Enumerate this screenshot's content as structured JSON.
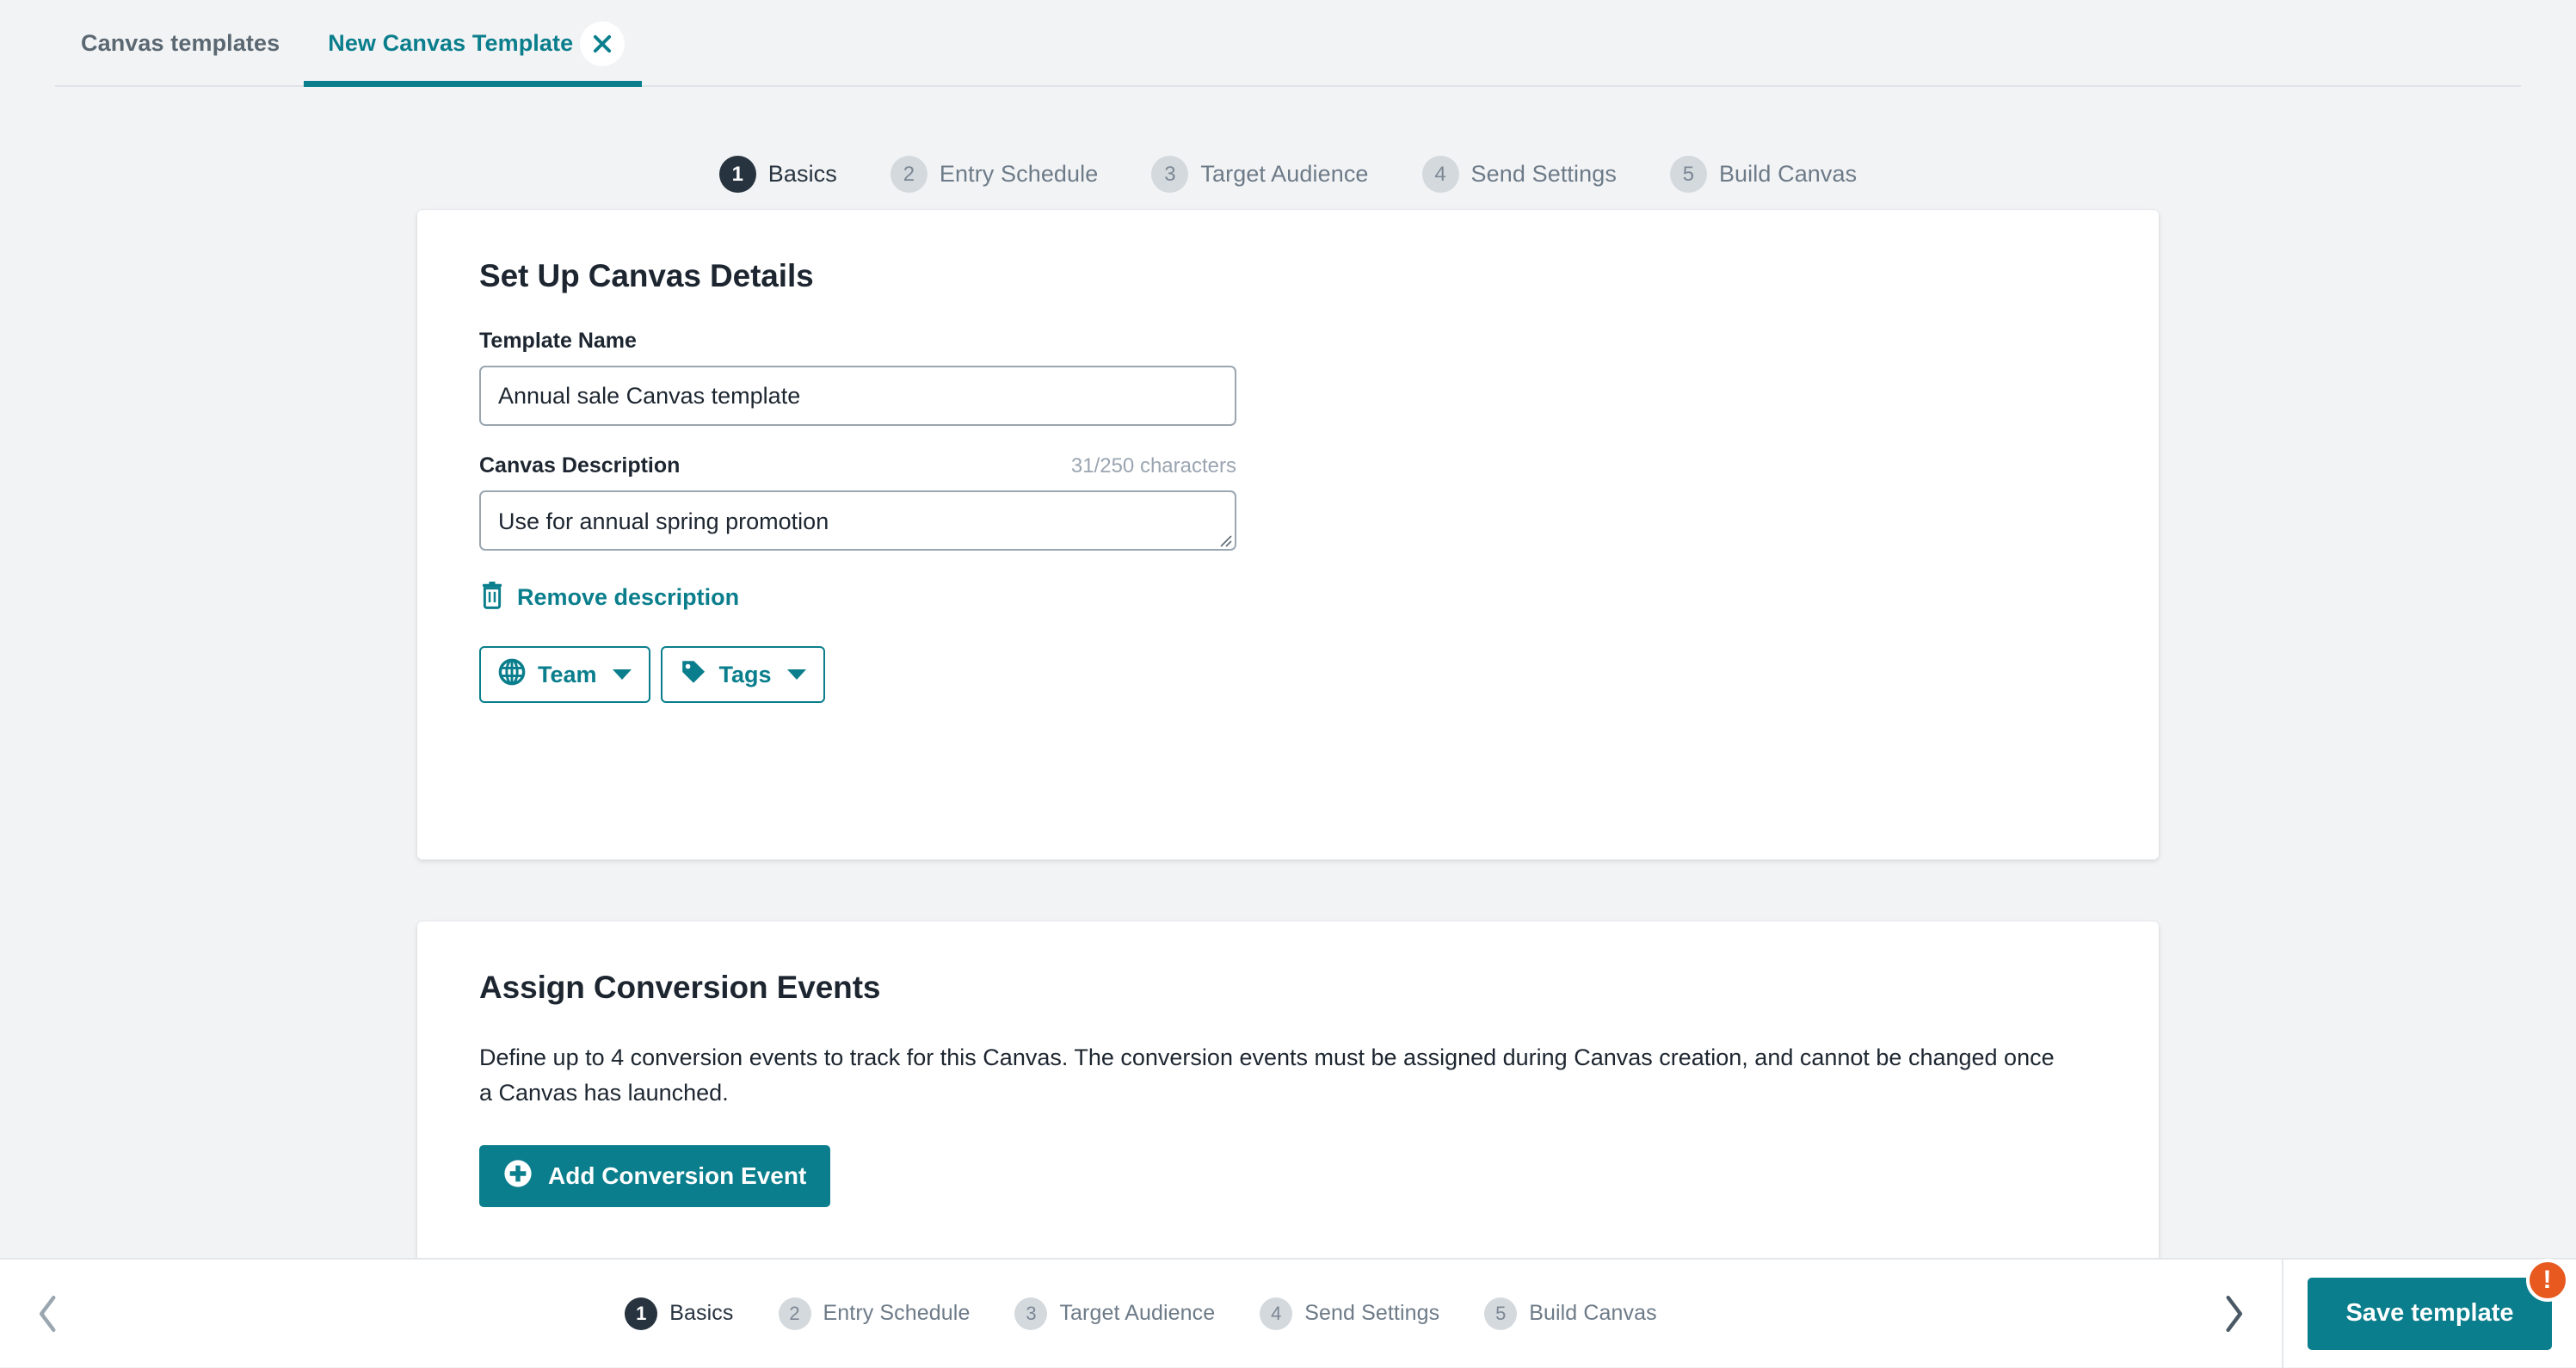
{
  "tabs": [
    {
      "label": "Canvas templates",
      "active": false
    },
    {
      "label": "New Canvas Template",
      "active": true,
      "closable": true
    }
  ],
  "steps": [
    {
      "num": "1",
      "label": "Basics"
    },
    {
      "num": "2",
      "label": "Entry Schedule"
    },
    {
      "num": "3",
      "label": "Target Audience"
    },
    {
      "num": "4",
      "label": "Send Settings"
    },
    {
      "num": "5",
      "label": "Build Canvas"
    }
  ],
  "current_step": "1",
  "card_details": {
    "title": "Set Up Canvas Details",
    "template_name_label": "Template Name",
    "template_name_value": "Annual sale Canvas template",
    "template_name_placeholder": "Template Name",
    "description_label": "Canvas Description",
    "description_counter": "31/250 characters",
    "description_value": "Use for annual spring promotion",
    "description_placeholder": "Canvas Description",
    "remove_description_label": "Remove description",
    "team_button_label": "Team",
    "tags_button_label": "Tags"
  },
  "card_conversion": {
    "title": "Assign Conversion Events",
    "body": "Define up to 4 conversion events to track for this Canvas. The conversion events must be assigned during Canvas creation, and cannot be changed once a Canvas has launched.",
    "add_button_label": "Add Conversion Event"
  },
  "bottom_bar": {
    "save_label": "Save template",
    "badge": "!"
  },
  "colors": {
    "accent": "#0a7e8c",
    "page_bg": "#f2f3f5",
    "step_active": "#27333f",
    "step_inactive": "#d4d9dd",
    "badge": "#e8591f",
    "text": "#1d2630",
    "muted": "#6d7b88"
  }
}
